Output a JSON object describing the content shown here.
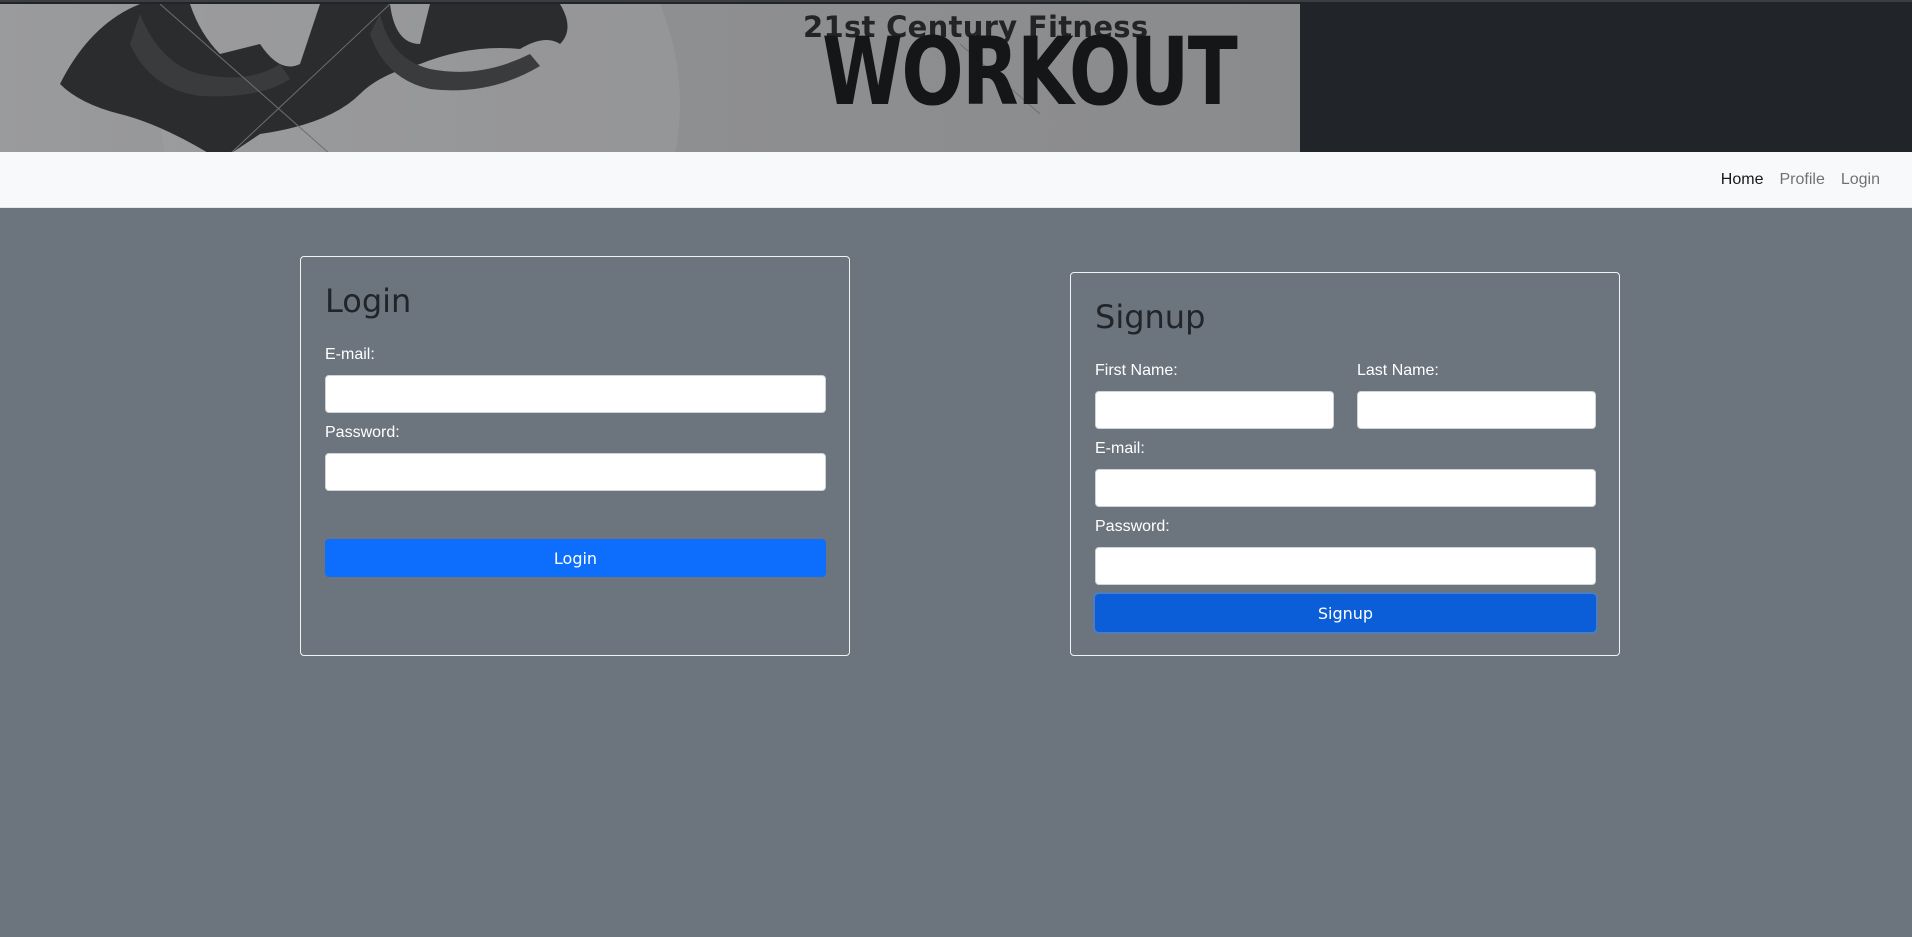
{
  "banner": {
    "line1": "21st Century Fitness",
    "line2": "WORKOUT"
  },
  "nav": {
    "items": [
      {
        "label": "Home"
      },
      {
        "label": "Profile"
      },
      {
        "label": "Login"
      }
    ]
  },
  "login": {
    "title": "Login",
    "email_label": "E-mail:",
    "email_value": "",
    "password_label": "Password:",
    "password_value": "",
    "button": "Login"
  },
  "signup": {
    "title": "Signup",
    "first_name_label": "First Name:",
    "first_name_value": "",
    "last_name_label": "Last Name:",
    "last_name_value": "",
    "email_label": "E-mail:",
    "email_value": "",
    "password_label": "Password:",
    "password_value": "",
    "button": "Signup"
  },
  "colors": {
    "page_background": "#6c757d",
    "banner_background": "#212529",
    "navbar_background": "#f8f9fa",
    "primary": "#0d6efd"
  }
}
